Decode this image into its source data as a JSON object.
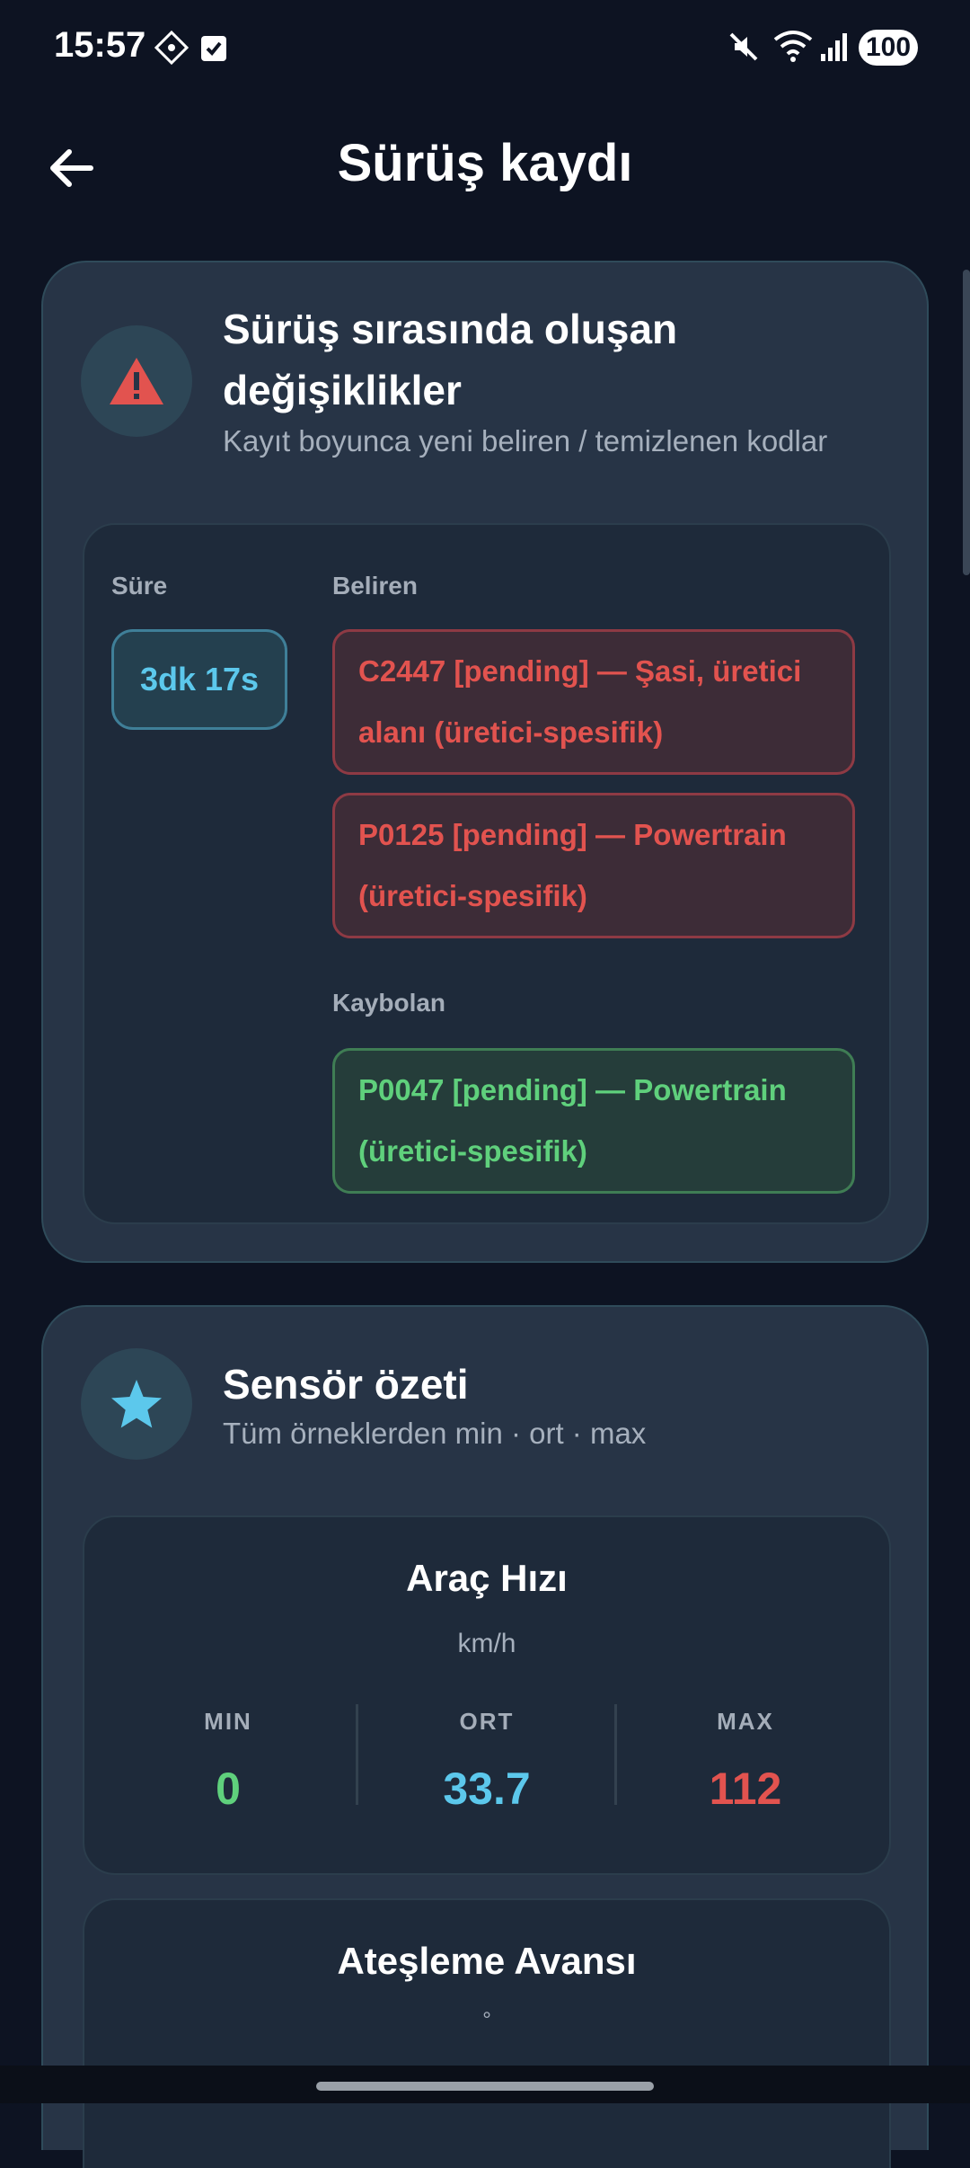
{
  "status_bar": {
    "time": "15:57",
    "battery": "100"
  },
  "app_bar": {
    "title": "Sürüş kaydı"
  },
  "changes_card": {
    "title_line1": "Sürüş sırasında oluşan",
    "title_line2": "değişiklikler",
    "subtitle": "Kayıt boyunca yeni beliren / temizlenen kodlar",
    "duration_label": "Süre",
    "duration_value": "3dk 17s",
    "appeared_label": "Beliren",
    "appeared": [
      {
        "line1": "C2447 [pending] — Şasi, üretici",
        "line2": "alanı (üretici-spesifik)"
      },
      {
        "line1": "P0125 [pending] — Powertrain",
        "line2": "(üretici-spesifik)"
      }
    ],
    "cleared_label": "Kaybolan",
    "cleared": [
      {
        "line1": "P0047 [pending] — Powertrain",
        "line2": "(üretici-spesifik)"
      }
    ]
  },
  "sensor_card": {
    "title": "Sensör özeti",
    "subtitle": "Tüm örneklerden min · ort · max",
    "sensors": [
      {
        "name": "Araç Hızı",
        "unit": "km/h",
        "min_label": "MIN",
        "min": "0",
        "avg_label": "ORT",
        "avg": "33.7",
        "max_label": "MAX",
        "max": "112"
      },
      {
        "name": "Ateşleme Avansı",
        "unit": "°"
      }
    ]
  },
  "colors": {
    "background": "#0d1322",
    "card": "#273446",
    "accent_blue": "#5cc8ec",
    "red": "#e2534f",
    "green": "#5fd07c"
  }
}
